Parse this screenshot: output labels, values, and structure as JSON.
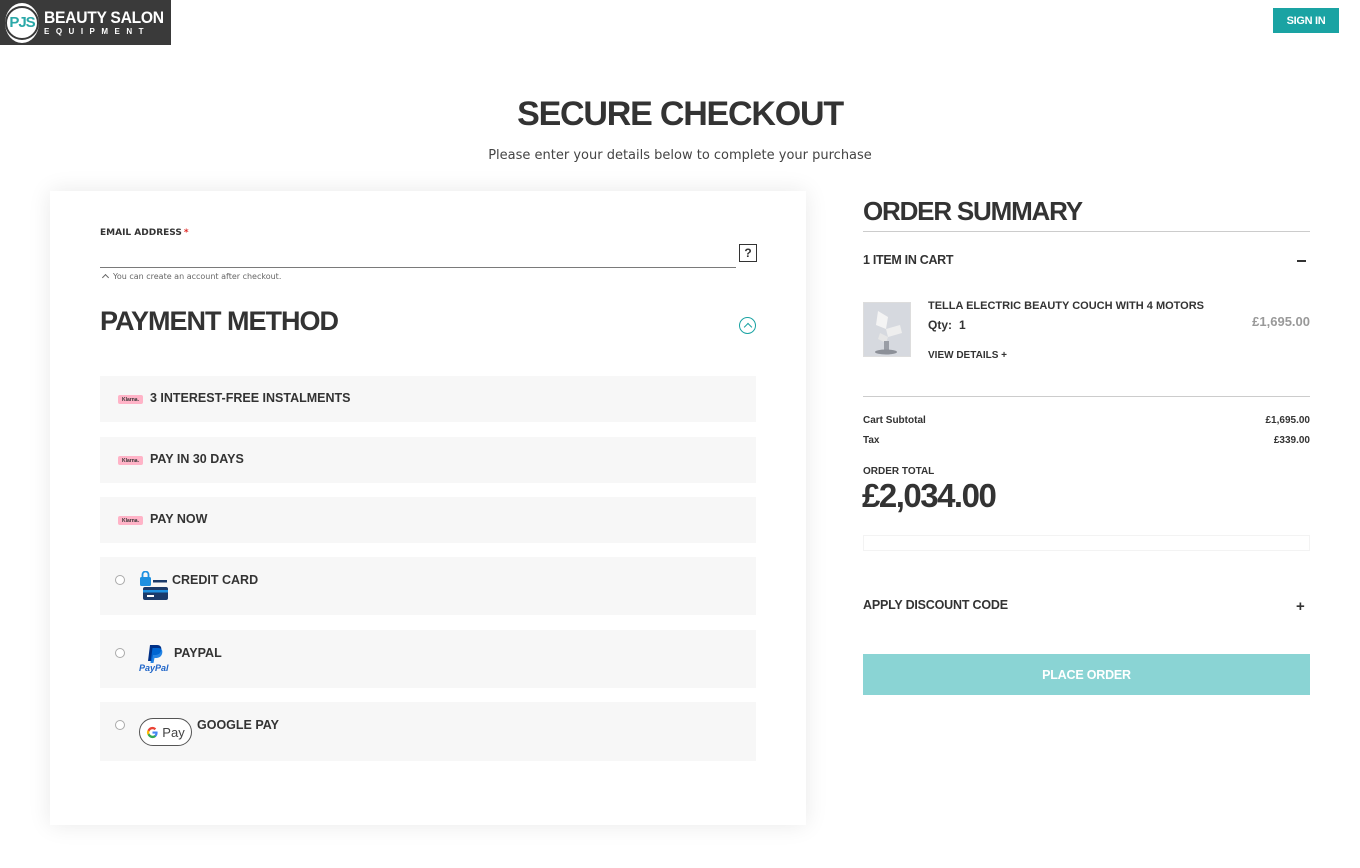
{
  "header": {
    "logo_initials": "PJS",
    "logo_title": "BEAUTY SALON",
    "logo_subtitle": "EQUIPMENT",
    "signin_label": "SIGN IN"
  },
  "page": {
    "title": "SECURE CHECKOUT",
    "subtitle": "Please enter your details below to complete your purchase"
  },
  "email": {
    "label": "EMAIL ADDRESS",
    "required_mark": "*",
    "value": "",
    "help_glyph": "?",
    "note": "You can create an account after checkout."
  },
  "payment": {
    "title": "PAYMENT METHOD",
    "klarna_badge": "Klarna.",
    "options": [
      {
        "label": "3 INTEREST-FREE INSTALMENTS",
        "icon": "klarna-icon"
      },
      {
        "label": "PAY IN 30 DAYS",
        "icon": "klarna-icon"
      },
      {
        "label": "PAY NOW",
        "icon": "klarna-icon"
      },
      {
        "label": "CREDIT CARD",
        "icon": "credit-card-icon"
      },
      {
        "label": "PAYPAL",
        "icon": "paypal-icon",
        "logo_text": "PayPal"
      },
      {
        "label": "GOOGLE PAY",
        "icon": "google-pay-icon",
        "logo_text": "Pay"
      }
    ]
  },
  "summary": {
    "title": "ORDER SUMMARY",
    "items_heading": "1 ITEM IN CART",
    "item": {
      "name": "TELLA ELECTRIC BEAUTY COUCH WITH 4 MOTORS",
      "qty_label": "Qty:",
      "qty": "1",
      "price": "£1,695.00",
      "view_details": "VIEW DETAILS +"
    },
    "subtotal_label": "Cart Subtotal",
    "subtotal_value": "£1,695.00",
    "tax_label": "Tax",
    "tax_value": "£339.00",
    "order_total_label": "ORDER TOTAL",
    "order_total_value": "£2,034.00",
    "discount_label": "APPLY DISCOUNT CODE",
    "discount_toggle": "+",
    "place_order_label": "PLACE ORDER"
  },
  "colors": {
    "accent": "#1aa3a3",
    "place_order_bg": "#8ad4d4",
    "klarna_pink": "#ffb3c7",
    "paypal_blue": "#003087",
    "card_blue": "#1e90e0"
  }
}
